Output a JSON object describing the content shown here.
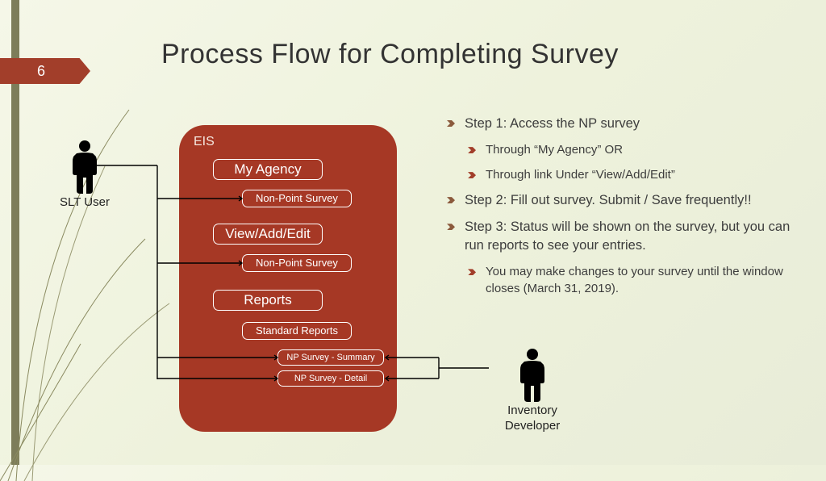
{
  "slide_number": "6",
  "title": "Process Flow for Completing Survey",
  "slt_user_label": "SLT User",
  "inventory_dev_label_1": "Inventory",
  "inventory_dev_label_2": "Developer",
  "eis": {
    "label": "EIS",
    "my_agency": "My Agency",
    "np_survey_1": "Non-Point Survey",
    "view_add_edit": "View/Add/Edit",
    "np_survey_2": "Non-Point Survey",
    "reports": "Reports",
    "std_reports": "Standard Reports",
    "np_summary": "NP Survey - Summary",
    "np_detail": "NP Survey - Detail"
  },
  "steps": {
    "s1": "Step 1:  Access the NP survey",
    "s1a": "Through “My Agency” OR",
    "s1b": "Through link Under “View/Add/Edit”",
    "s2": "Step 2:  Fill out survey.  Submit / Save frequently!!",
    "s3": "Step 3:  Status will be shown on the survey, but you can run reports to see your entries.",
    "s3a": "You may make changes to your survey until the window closes (March 31, 2019)."
  }
}
